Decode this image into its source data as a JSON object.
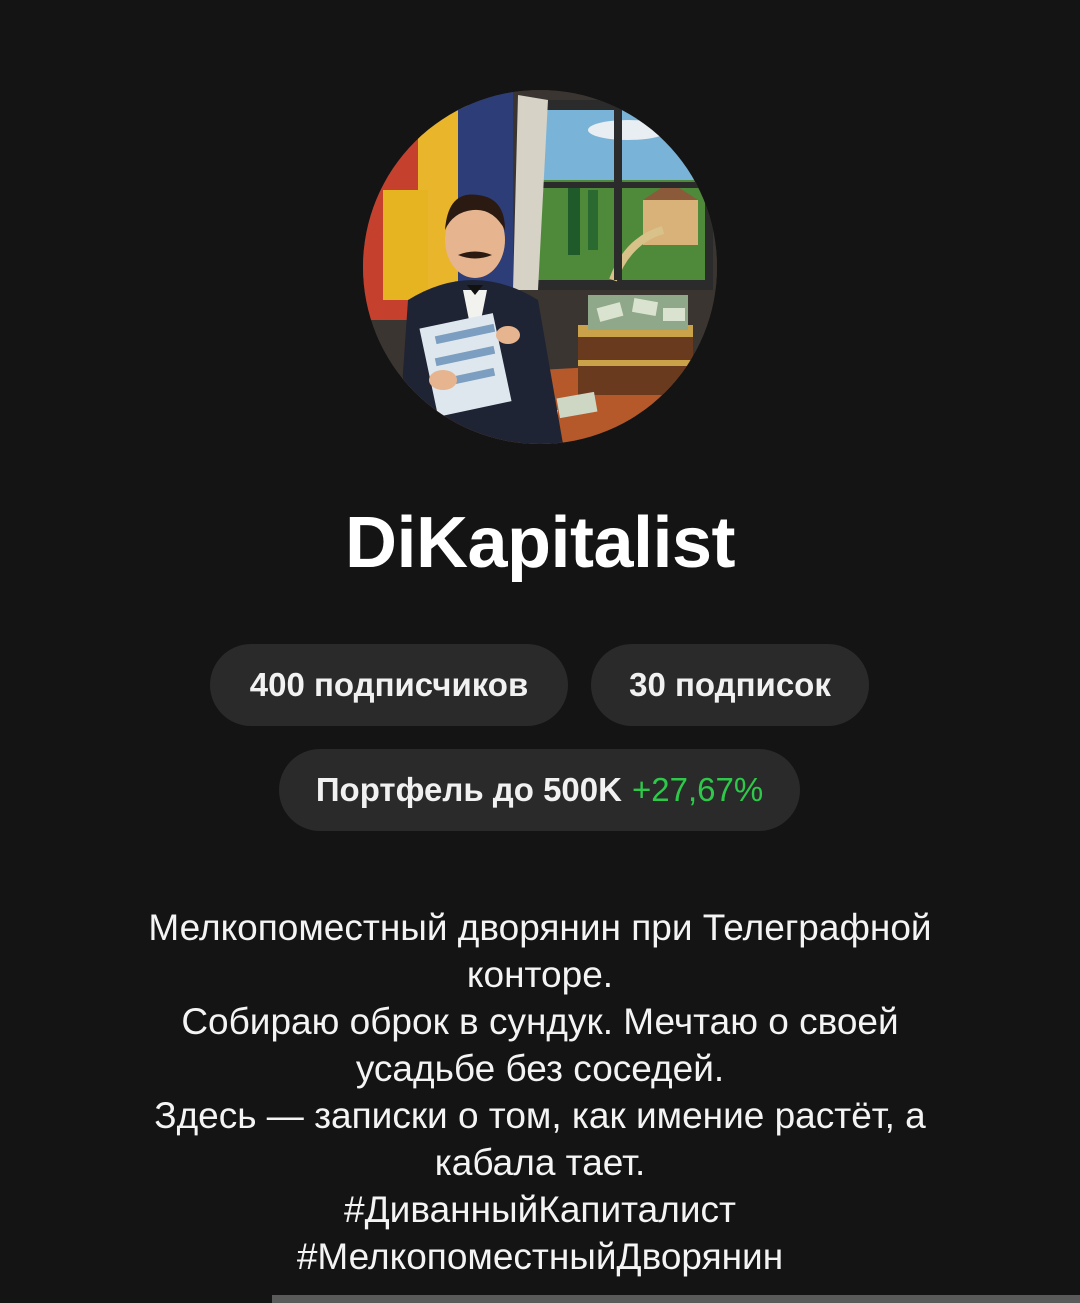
{
  "profile": {
    "name": "DiKapitalist",
    "avatar_icon": "avatar-painting-gentleman-with-money",
    "stats": {
      "subscribers": "400 подписчиков",
      "subscriptions": "30 подписок"
    },
    "portfolio": {
      "label": "Портфель до 500K",
      "gain": "+27,67%",
      "gain_color": "#2ec94a"
    },
    "bio_lines": [
      "Мелкопоместный дворянин при Телеграфной",
      "конторе.",
      "Собираю оброк в сундук. Мечтаю о своей",
      "усадьбе без соседей.",
      "Здесь — записки о том, как имение  растёт, а",
      "кабала тает.",
      "#ДиванныйКапиталист",
      "#МелкопоместныйДворянин"
    ]
  }
}
